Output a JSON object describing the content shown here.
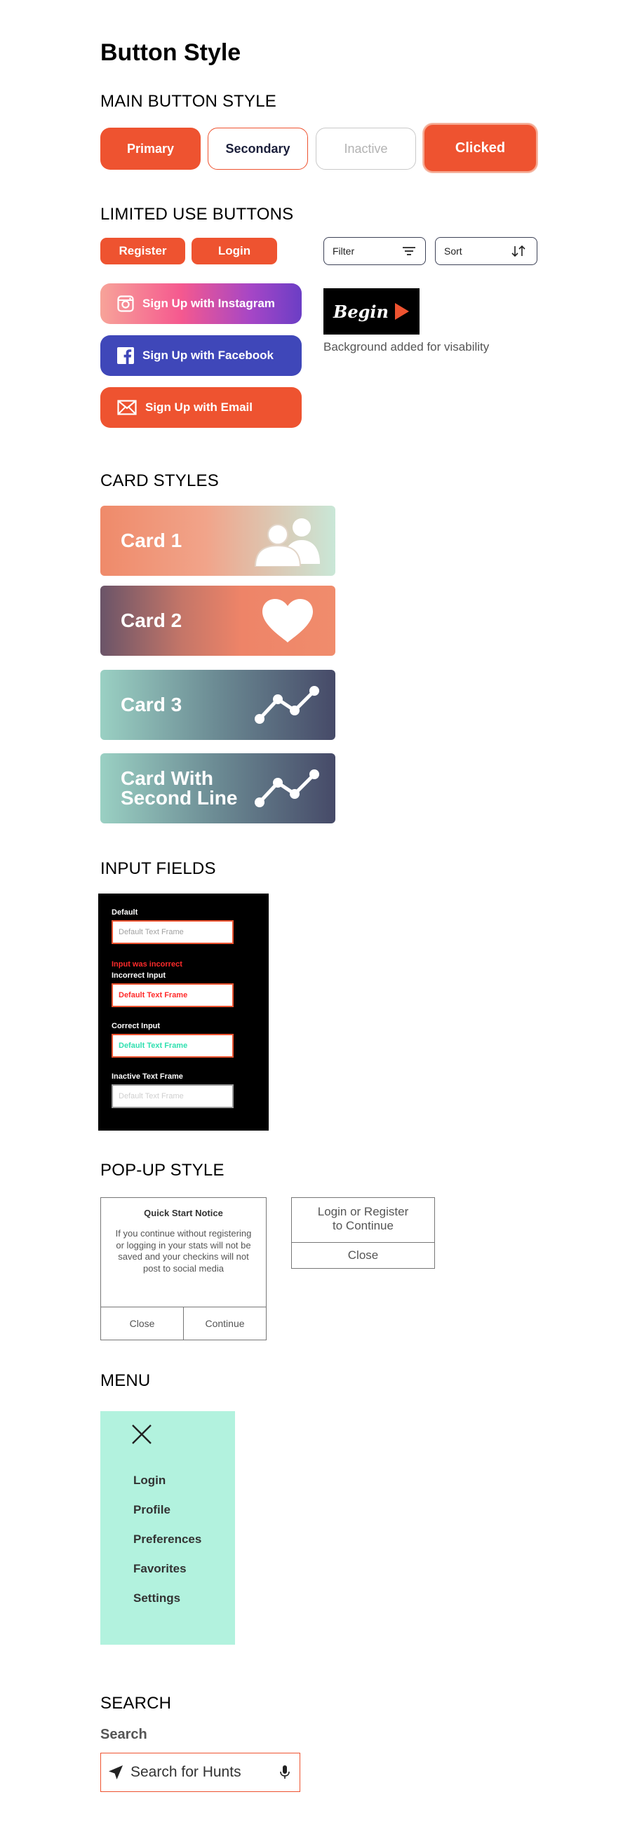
{
  "page": {
    "title": "Button Style"
  },
  "main_buttons": {
    "section_title": "MAIN BUTTON STYLE",
    "primary": "Primary",
    "secondary": "Secondary",
    "inactive": "Inactive",
    "clicked": "Clicked"
  },
  "limited": {
    "section_title": "LIMITED USE BUTTONS",
    "register": "Register",
    "login": "Login",
    "filter": "Filter",
    "sort": "Sort",
    "instagram": "Sign Up with Instagram",
    "facebook": "Sign Up with Facebook",
    "email": "Sign Up with Email",
    "begin": "Begin",
    "begin_note": "Background added for visability"
  },
  "cards": {
    "section_title": "CARD STYLES",
    "items": [
      {
        "label": "Card 1",
        "icon": "users-icon"
      },
      {
        "label": "Card 2",
        "icon": "heart-icon"
      },
      {
        "label": "Card 3",
        "icon": "trend-line-icon"
      },
      {
        "label_line1": "Card With",
        "label_line2": "Second Line",
        "icon": "trend-line-icon"
      }
    ]
  },
  "inputs": {
    "section_title": "INPUT FIELDS",
    "default_label": "Default",
    "default_value": "Default Text Frame",
    "error_message": "Input was incorrect",
    "incorrect_label": "Incorrect Input",
    "incorrect_value": "Default Text Frame",
    "correct_label": "Correct Input",
    "correct_value": "Default Text Frame",
    "inactive_label": "Inactive Text Frame",
    "inactive_value": "Default Text Frame"
  },
  "popup": {
    "section_title": "POP-UP STYLE",
    "notice_title": "Quick Start Notice",
    "notice_body": "If you continue without registering or logging in your stats will not be saved and your checkins will not post to social media",
    "close": "Close",
    "continue": "Continue",
    "login_prompt_line1": "Login or Register",
    "login_prompt_line2": "to Continue",
    "login_close": "Close"
  },
  "menu": {
    "section_title": "MENU",
    "items": [
      "Login",
      "Profile",
      "Preferences",
      "Favorites",
      "Settings"
    ]
  },
  "search": {
    "section_title": "SEARCH",
    "label": "Search",
    "placeholder": "Search for Hunts"
  },
  "colors": {
    "accent": "#ee5330",
    "navy": "#1b1f3b",
    "facebook": "#3f47b9",
    "menu_bg": "#b2f2de",
    "correct": "#30e0b0",
    "error": "#ff2b2b"
  }
}
